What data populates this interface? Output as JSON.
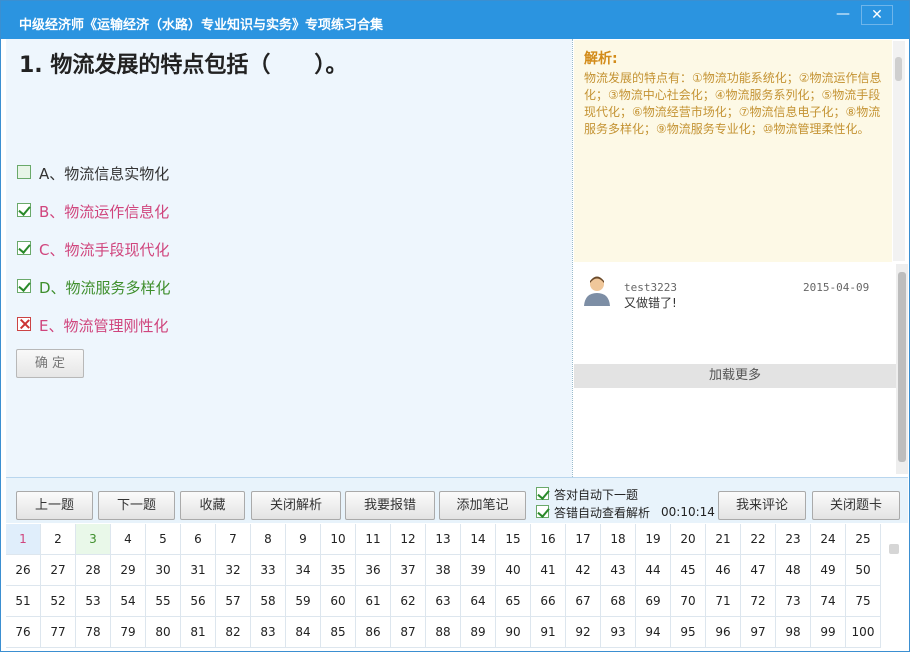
{
  "window": {
    "title": "中级经济师《运输经济（水路）专业知识与实务》专项练习合集",
    "min": "—",
    "close": "✕"
  },
  "question": {
    "text": "1. 物流发展的特点包括（　　）。",
    "options": [
      {
        "label": "A、物流信息实物化",
        "state": "unchecked",
        "color": "black"
      },
      {
        "label": "B、物流运作信息化",
        "state": "checked",
        "color": "pink"
      },
      {
        "label": "C、物流手段现代化",
        "state": "checked",
        "color": "pink"
      },
      {
        "label": "D、物流服务多样化",
        "state": "checked",
        "color": "green"
      },
      {
        "label": "E、物流管理刚性化",
        "state": "wrong",
        "color": "pink"
      }
    ],
    "confirm": "确 定"
  },
  "analysis": {
    "heading": "解析:",
    "body": "物流发展的特点有：①物流功能系统化；②物流运作信息化；③物流中心社会化；④物流服务系列化；⑤物流手段现代化；⑥物流经营市场化；⑦物流信息电子化；⑧物流服务多样化；⑨物流服务专业化；⑩物流管理柔性化。"
  },
  "comment": {
    "user": "test3223",
    "date": "2015-04-09",
    "text": "又做错了!",
    "load_more": "加载更多"
  },
  "toolbar": {
    "prev": "上一题",
    "next": "下一题",
    "favorite": "收藏",
    "close_analysis": "关闭解析",
    "report": "我要报错",
    "add_note": "添加笔记",
    "auto_next": "答对自动下一题",
    "auto_analysis": "答错自动查看解析",
    "timer": "00:10:14",
    "comment": "我来评论",
    "close_card": "关闭题卡"
  },
  "answer_card": {
    "current": 1,
    "done": [
      3
    ],
    "total": 100
  },
  "colors": {
    "accent": "#2b94e0",
    "pink": "#d0457d",
    "green": "#3f8f2d",
    "analysis": "#c49333"
  }
}
